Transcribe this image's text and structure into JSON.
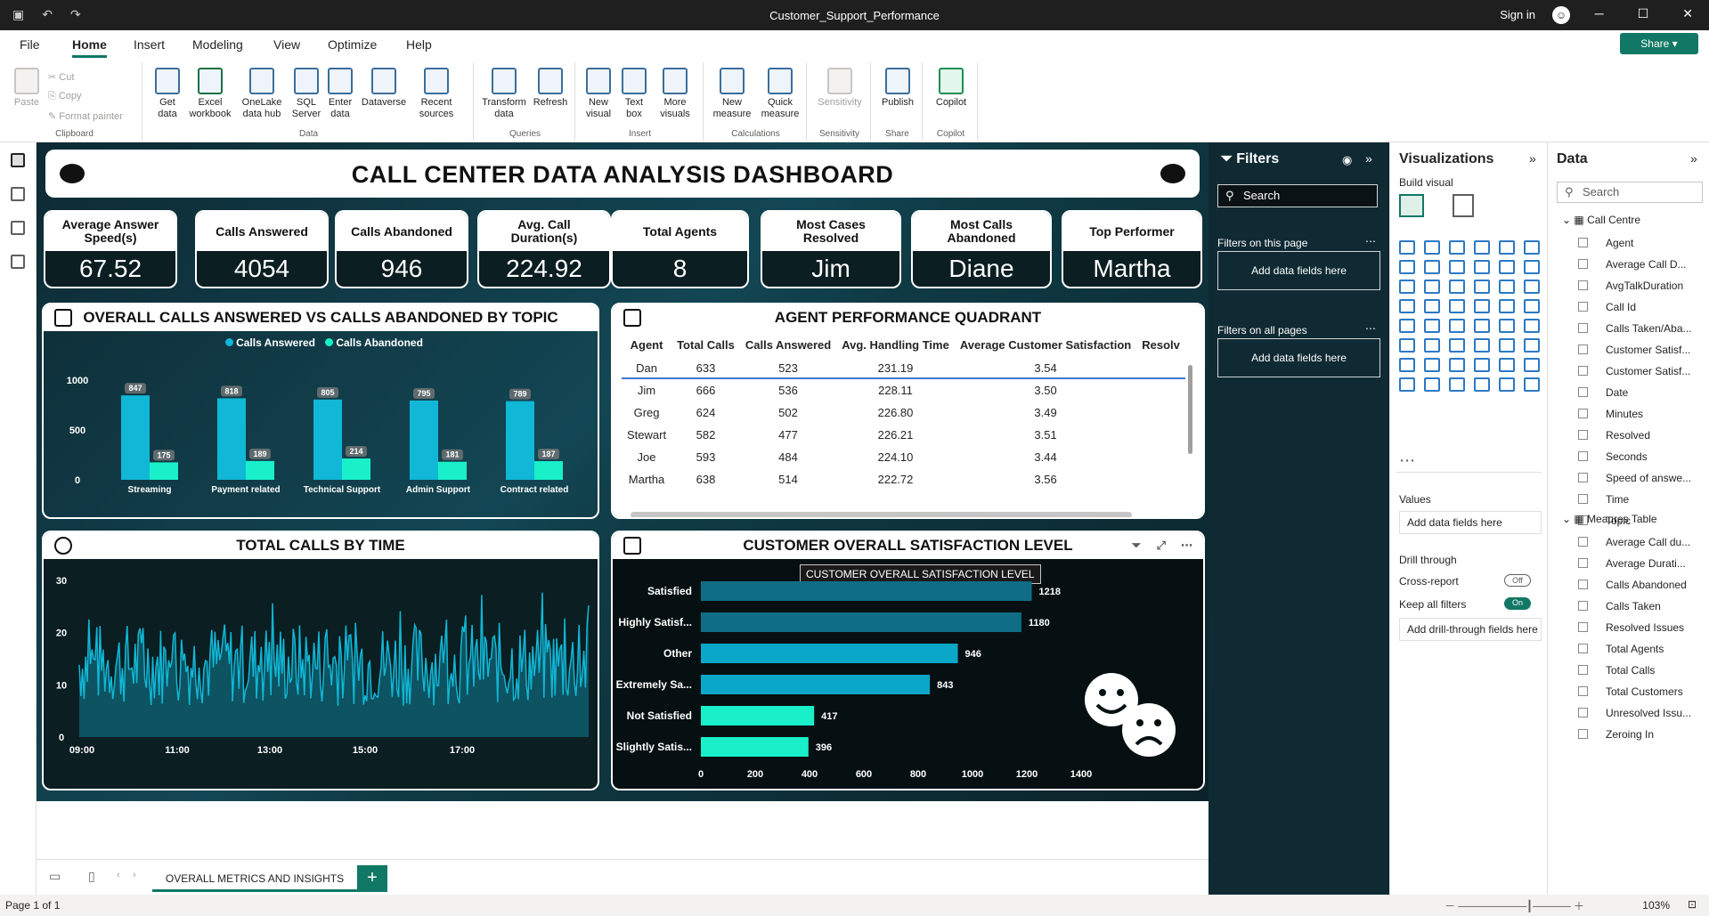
{
  "titlebar": {
    "doc_title": "Customer_Support_Performance",
    "sign_in": "Sign in"
  },
  "menu": [
    "File",
    "Home",
    "Insert",
    "Modeling",
    "View",
    "Optimize",
    "Help"
  ],
  "share": "Share",
  "ribbon": {
    "clipboard": {
      "paste": "Paste",
      "cut": "Cut",
      "copy": "Copy",
      "format_painter": "Format painter",
      "group": "Clipboard"
    },
    "data": {
      "get_data": "Get data",
      "excel": "Excel workbook",
      "onelake": "OneLake data hub",
      "sql": "SQL Server",
      "enter": "Enter data",
      "dataverse": "Dataverse",
      "recent": "Recent sources",
      "group": "Data"
    },
    "queries": {
      "transform": "Transform data",
      "refresh": "Refresh",
      "group": "Queries"
    },
    "insert": {
      "new_visual": "New visual",
      "text_box": "Text box",
      "more_visuals": "More visuals",
      "group": "Insert"
    },
    "calculations": {
      "new_measure": "New measure",
      "quick_measure": "Quick measure",
      "group": "Calculations"
    },
    "sensitivity": {
      "label": "Sensitivity",
      "group": "Sensitivity"
    },
    "share": {
      "publish": "Publish",
      "group": "Share"
    },
    "copilot": {
      "label": "Copilot",
      "group": "Copilot"
    }
  },
  "dashboard": {
    "title": "CALL CENTER DATA ANALYSIS DASHBOARD",
    "kpis": [
      {
        "label": "Average Answer Speed(s)",
        "value": "67.52"
      },
      {
        "label": "Calls Answered",
        "value": "4054"
      },
      {
        "label": "Calls Abandoned",
        "value": "946"
      },
      {
        "label": "Avg. Call Duration(s)",
        "value": "224.92"
      },
      {
        "label": "Total Agents",
        "value": "8"
      },
      {
        "label": "Most Cases Resolved",
        "value": "Jim"
      },
      {
        "label": "Most Calls Abandoned",
        "value": "Diane"
      },
      {
        "label": "Top Performer",
        "value": "Martha"
      }
    ],
    "topic_chart_title": "OVERALL CALLS ANSWERED VS CALLS ABANDONED BY TOPIC",
    "quadrant_title": "AGENT PERFORMANCE QUADRANT",
    "time_chart_title": "TOTAL CALLS BY TIME",
    "satisfaction_title": "CUSTOMER OVERALL SATISFACTION LEVEL",
    "tooltip": "CUSTOMER OVERALL SATISFACTION LEVEL"
  },
  "agent_table": {
    "headers": [
      "Agent",
      "Total Calls",
      "Calls Answered",
      "Avg. Handling Time",
      "Average Customer Satisfaction",
      "Resolv"
    ],
    "rows": [
      [
        "Dan",
        "633",
        "523",
        "231.19",
        "3.54"
      ],
      [
        "Jim",
        "666",
        "536",
        "228.11",
        "3.50"
      ],
      [
        "Greg",
        "624",
        "502",
        "226.80",
        "3.49"
      ],
      [
        "Stewart",
        "582",
        "477",
        "226.21",
        "3.51"
      ],
      [
        "Joe",
        "593",
        "484",
        "224.10",
        "3.44"
      ],
      [
        "Martha",
        "638",
        "514",
        "222.72",
        "3.56"
      ]
    ]
  },
  "chart_data": [
    {
      "type": "bar",
      "title": "OVERALL CALLS ANSWERED VS CALLS ABANDONED BY TOPIC",
      "categories": [
        "Streaming",
        "Payment related",
        "Technical Support",
        "Admin Support",
        "Contract related"
      ],
      "series": [
        {
          "name": "Calls Answered",
          "values": [
            847,
            818,
            805,
            795,
            789
          ],
          "color": "#11b7d6"
        },
        {
          "name": "Calls Abandoned",
          "values": [
            175,
            189,
            214,
            181,
            187
          ],
          "color": "#19f0c9"
        }
      ],
      "ylim": [
        0,
        1000
      ],
      "yticks": [
        0,
        500,
        1000
      ],
      "legend": "top-center"
    },
    {
      "type": "line",
      "title": "TOTAL CALLS BY TIME",
      "xticks": [
        "09:00",
        "11:00",
        "13:00",
        "15:00",
        "17:00"
      ],
      "ylim": [
        0,
        30
      ],
      "yticks": [
        0,
        10,
        20,
        30
      ],
      "series": [
        {
          "name": "",
          "color": "#11b7d6"
        }
      ]
    },
    {
      "type": "bar",
      "orientation": "horizontal",
      "title": "CUSTOMER OVERALL SATISFACTION LEVEL",
      "categories": [
        "Satisfied",
        "Highly Satisf...",
        "Other",
        "Extremely Sa...",
        "Not Satisfied",
        "Slightly Satis..."
      ],
      "values": [
        1218,
        1180,
        946,
        843,
        417,
        396
      ],
      "colors": [
        "#0f6e85",
        "#0f6e85",
        "#0aa7c9",
        "#0aa7c9",
        "#19f0c9",
        "#19f0c9"
      ],
      "xlim": [
        0,
        1400
      ],
      "xticks": [
        0,
        200,
        400,
        600,
        800,
        1000,
        1200,
        1400
      ]
    }
  ],
  "filters": {
    "title": "Filters",
    "search": "Search",
    "on_page": "Filters on this page",
    "on_all": "Filters on all pages",
    "add": "Add data fields here"
  },
  "visualizations": {
    "title": "Visualizations",
    "build": "Build visual",
    "values": "Values",
    "values_add": "Add data fields here",
    "drill": "Drill through",
    "cross": "Cross-report",
    "cross_state": "Off",
    "keep": "Keep all filters",
    "keep_state": "On",
    "drill_add": "Add drill-through fields here"
  },
  "data_pane": {
    "title": "Data",
    "search": "Search",
    "table1": "Call Centre",
    "fields1": [
      "Agent",
      "Average Call D...",
      "AvgTalkDuration",
      "Call Id",
      "Calls Taken/Aba...",
      "Customer Satisf...",
      "Customer Satisf...",
      "Date",
      "Minutes",
      "Resolved",
      "Seconds",
      "Speed of answe...",
      "Time",
      "Topic"
    ],
    "table2": "Meaures Table",
    "fields2": [
      "Average Call du...",
      "Average Durati...",
      "Calls Abandoned",
      "Calls Taken",
      "Resolved Issues",
      "Total Agents",
      "Total Calls",
      "Total Customers",
      "Unresolved Issu...",
      "Zeroing In"
    ]
  },
  "page_tab": "OVERALL METRICS AND INSIGHTS",
  "status": {
    "page": "Page 1 of 1",
    "zoom": "103%"
  }
}
